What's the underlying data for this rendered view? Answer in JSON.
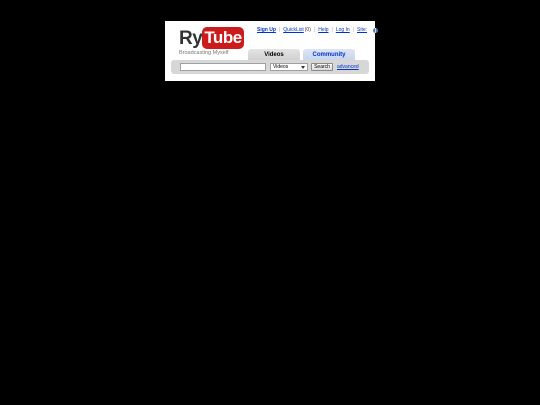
{
  "logo": {
    "part1": "Ry",
    "part2": "Tube",
    "tagline": "Broadcasting Myself"
  },
  "utility": {
    "sign_up": "Sign Up",
    "quicklist": "QuickList",
    "quicklist_count": "(0)",
    "help": "Help",
    "log_in": "Log In",
    "site": "Site:",
    "globe_icon": "globe-icon"
  },
  "tabs": [
    {
      "label": "Videos"
    },
    {
      "label": "Community"
    }
  ],
  "search": {
    "value": "",
    "placeholder": "",
    "select_value": "Videos",
    "button_label": "Search",
    "advanced_label": "advanced"
  },
  "colors": {
    "logo_red": "#cc1b1b",
    "link_blue": "#0033cc",
    "background": "#000000"
  }
}
